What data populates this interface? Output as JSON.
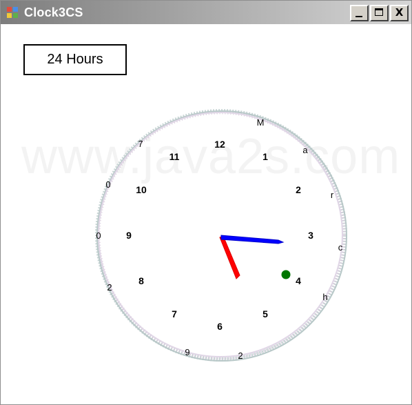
{
  "window": {
    "title": "Clock3CS",
    "minimize_label": "_",
    "maximize_label": "",
    "close_label": "X"
  },
  "toolbar": {
    "hours_button_label": "24 Hours"
  },
  "watermark": "www.java2s.com",
  "clock": {
    "numbers": [
      "12",
      "1",
      "2",
      "3",
      "4",
      "5",
      "6",
      "7",
      "8",
      "9",
      "10",
      "11"
    ],
    "ring_letters": [
      "M",
      "a",
      "r",
      "c",
      "h",
      "2",
      "9",
      "2",
      "0",
      "0",
      "7"
    ],
    "hour_hand_color": "#0000ff",
    "minute_hand_color": "#ff0000",
    "second_dot_color": "#007700"
  },
  "icons": [
    "app-icon",
    "minimize-icon",
    "maximize-icon",
    "close-icon"
  ]
}
